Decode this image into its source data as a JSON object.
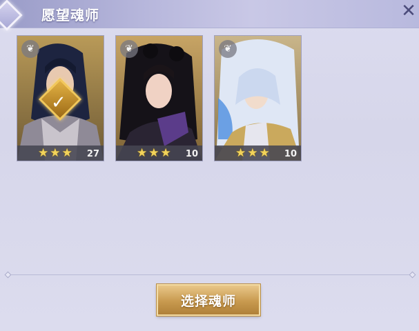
{
  "window": {
    "title": "愿望魂师",
    "close_icon": "close-icon"
  },
  "cards": [
    {
      "name_hint": "hero-1",
      "stars": "★★★",
      "level": "27",
      "selected": true,
      "badge_icon": "wing-icon"
    },
    {
      "name_hint": "hero-2",
      "stars": "★★★",
      "level": "10",
      "selected": false,
      "badge_icon": "wing-icon"
    },
    {
      "name_hint": "hero-3",
      "stars": "★★★",
      "level": "10",
      "selected": false,
      "badge_icon": "wing-icon"
    }
  ],
  "actions": {
    "select_label": "选择魂师"
  },
  "colors": {
    "accent_gold": "#d2a85c",
    "star": "#f2d35a",
    "title_bar": "#b7b7dc"
  }
}
